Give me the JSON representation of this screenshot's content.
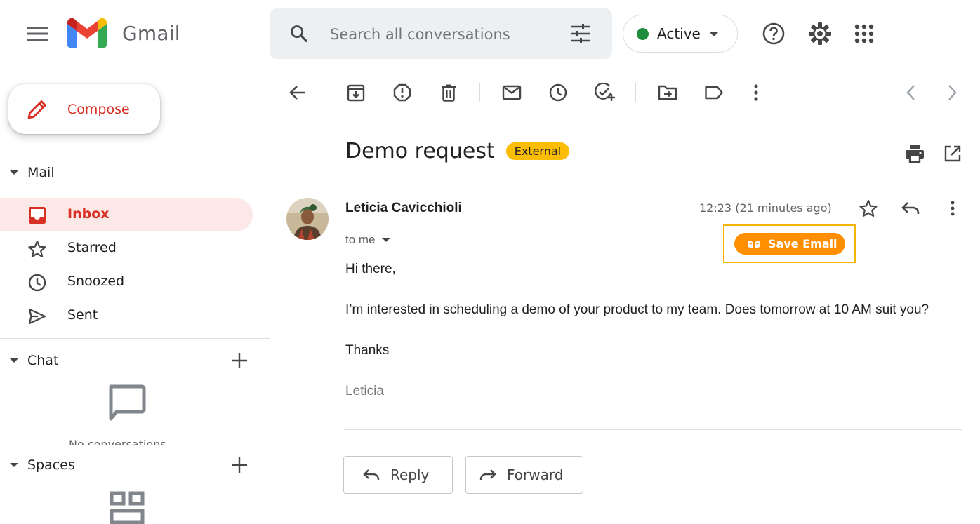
{
  "header": {
    "app_name": "Gmail",
    "search_placeholder": "Search all conversations",
    "status_label": "Active",
    "status_color": "#1e8e3e"
  },
  "sidebar": {
    "compose_label": "Compose",
    "mail_section": "Mail",
    "items": [
      {
        "label": "Inbox",
        "icon": "inbox-icon",
        "active": true
      },
      {
        "label": "Starred",
        "icon": "star-icon",
        "active": false
      },
      {
        "label": "Snoozed",
        "icon": "clock-icon",
        "active": false
      },
      {
        "label": "Sent",
        "icon": "send-icon",
        "active": false
      }
    ],
    "chat_section": "Chat",
    "chat_empty_text": "No conversations",
    "spaces_section": "Spaces"
  },
  "email": {
    "subject": "Demo request",
    "badge": "External",
    "sender": "Leticia Cavicchioli",
    "recipient": "to me",
    "time": "12:23 (21 minutes ago)",
    "save_email_label": "Save Email",
    "body": [
      "Hi there,",
      "I’m interested in scheduling a demo of your product to my team. Does tomorrow at 10 AM suit you?",
      "Thanks"
    ],
    "signature": "Leticia"
  },
  "actions": {
    "reply": "Reply",
    "forward": "Forward"
  },
  "colors": {
    "accent_red": "#d93025",
    "active_bg": "#fce8e6",
    "badge_yellow": "#fbbc04",
    "save_orange": "#ff8f00"
  }
}
